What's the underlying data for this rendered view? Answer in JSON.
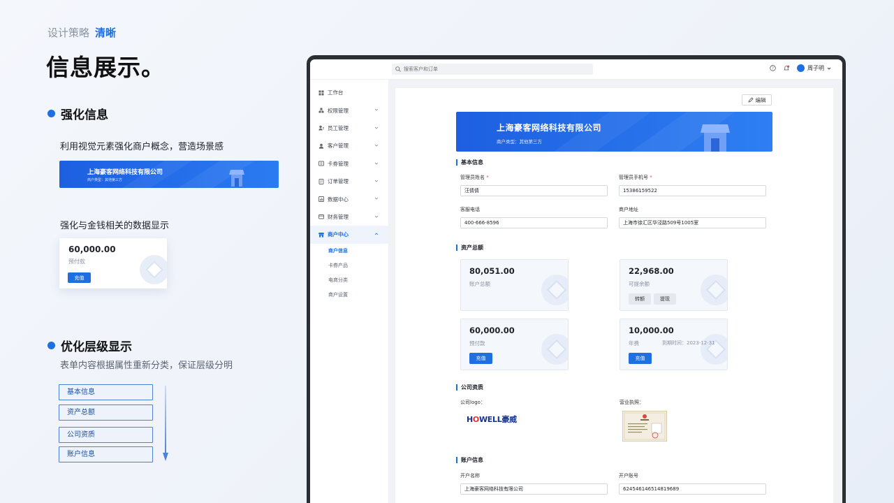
{
  "slide": {
    "kicker": "设计策略",
    "kicker_accent": "清晰",
    "headline": "信息展示。",
    "section1": {
      "title": "强化信息",
      "desc1": "利用视觉元素强化商户概念，营造场景感",
      "desc2": "强化与金钱相关的数据显示",
      "banner_name": "上海豪客网络科技有限公司",
      "banner_type": "商户类型：其他第三方",
      "card_value": "60,000.00",
      "card_label": "预付款",
      "card_button": "充值"
    },
    "section2": {
      "title": "优化层级显示",
      "desc": "表单内容根据属性重新分类，保证层级分明",
      "tags": [
        "基本信息",
        "资产总额",
        "公司资质",
        "账户信息"
      ]
    }
  },
  "app": {
    "search_placeholder": "搜索客户和订单",
    "user_name": "周子明",
    "nav": [
      {
        "label": "工作台",
        "icon": "dashboard-icon"
      },
      {
        "label": "权限管理",
        "icon": "permission-icon"
      },
      {
        "label": "员工管理",
        "icon": "staff-icon"
      },
      {
        "label": "客户管理",
        "icon": "customer-icon"
      },
      {
        "label": "卡券管理",
        "icon": "coupon-icon"
      },
      {
        "label": "订单管理",
        "icon": "order-icon"
      },
      {
        "label": "数据中心",
        "icon": "data-icon"
      },
      {
        "label": "财务管理",
        "icon": "finance-icon"
      },
      {
        "label": "商户中心",
        "icon": "merchant-icon"
      }
    ],
    "subnav": [
      "商户信息",
      "卡券产品",
      "电商分类",
      "商户设置"
    ],
    "edit_label": "编辑",
    "merchant_name": "上海豪客网络科技有限公司",
    "merchant_type": "商户类型：其他第三方",
    "basic": {
      "title": "基本信息",
      "admin_name_label": "管理员姓名",
      "admin_name": "汪倩倩",
      "admin_phone_label": "管理员手机号",
      "admin_phone": "15386159522",
      "service_phone_label": "客服电话",
      "service_phone": "400-666-8596",
      "address_label": "商户地址",
      "address": "上海市徐汇区华泾路509号1005室"
    },
    "assets": {
      "title": "资产总额",
      "total_value": "80,051.00",
      "total_label": "账户总额",
      "withdrawable_value": "22,968.00",
      "withdrawable_label": "可提余额",
      "transfer_btn": "转额",
      "withdraw_btn": "提现",
      "prepaid_value": "60,000.00",
      "prepaid_label": "预付款",
      "recharge_btn": "充值",
      "annual_value": "10,000.00",
      "annual_label": "年费",
      "due_label": "到期时间：2023-12-31",
      "annual_btn": "充值"
    },
    "qualification": {
      "title": "公司资质",
      "logo_label": "公司logo：",
      "logo_h": "H",
      "logo_o": "O",
      "logo_rest": "WELL豪威",
      "license_label": "营业执照："
    },
    "account": {
      "title": "账户信息",
      "name_label": "开户名称",
      "name": "上海豪客网络科技有限公司",
      "number_label": "开户账号",
      "number": "624546146514819689"
    }
  },
  "colors": {
    "accent": "#1e6fe0",
    "banner_start": "#1d5fe0",
    "banner_end": "#2e7ff3",
    "required": "#e34d4d"
  }
}
